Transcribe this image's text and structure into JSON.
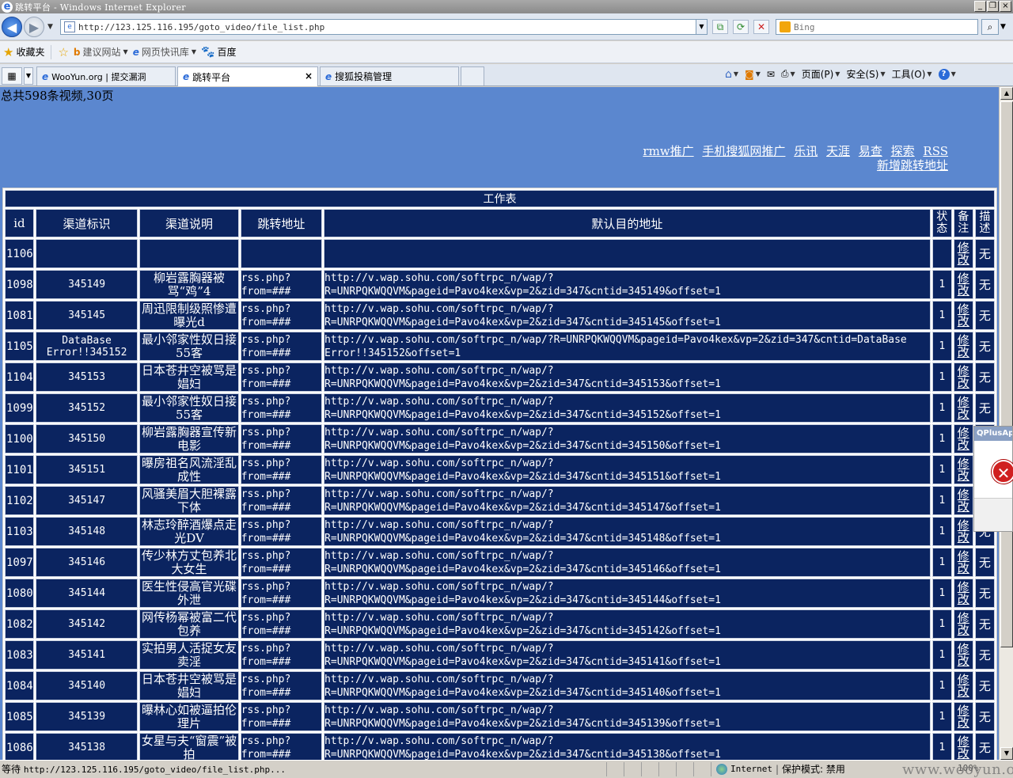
{
  "window": {
    "title": "跳转平台 - Windows Internet Explorer",
    "min": "_",
    "restore": "❐",
    "close": "×"
  },
  "address": {
    "url": "http://123.125.116.195/goto_video/file_list.php",
    "search_placeholder": "Bing"
  },
  "favorites": {
    "label": "收藏夹",
    "items": [
      {
        "label": "建议网站"
      },
      {
        "label": "网页快讯库"
      },
      {
        "label": "百度"
      }
    ]
  },
  "tabs": [
    {
      "label": "WooYun.org | 提交漏洞",
      "active": false
    },
    {
      "label": "跳转平台",
      "active": true
    },
    {
      "label": "搜狐投稿管理",
      "active": false
    }
  ],
  "commandbar": {
    "page": "页面(P)",
    "safety": "安全(S)",
    "tools": "工具(O)"
  },
  "page": {
    "total": "总共598条视频,30页",
    "nav_links": [
      {
        "label": "rmw推广"
      },
      {
        "label": "手机搜狐网推广"
      },
      {
        "label": "乐讯"
      },
      {
        "label": "天涯"
      },
      {
        "label": "易查"
      },
      {
        "label": "探索"
      },
      {
        "label": "RSS"
      }
    ],
    "add_link": "新增跳转地址"
  },
  "table": {
    "title": "工作表",
    "columns": [
      "id",
      "渠道标识",
      "渠道说明",
      "跳转地址",
      "默认目的地址",
      "状态",
      "备注",
      "描述"
    ],
    "edit_label": "修改",
    "none_label": "无",
    "rows": [
      {
        "id": "1106",
        "mark": "",
        "desc": "",
        "jump": "",
        "url": "",
        "state": ""
      },
      {
        "id": "1098",
        "mark": "345149",
        "desc": "柳岩露胸器被骂“鸡”4",
        "jump": "rss.php?from=###",
        "url": "http://v.wap.sohu.com/softrpc_n/wap/?R=UNRPQKWQQVM&pageid=Pavo4kex&vp=2&zid=347&cntid=345149&offset=1",
        "state": "1"
      },
      {
        "id": "1081",
        "mark": "345145",
        "desc": "周迅限制级照惨遭曝光d",
        "jump": "rss.php?from=###",
        "url": "http://v.wap.sohu.com/softrpc_n/wap/?R=UNRPQKWQQVM&pageid=Pavo4kex&vp=2&zid=347&cntid=345145&offset=1",
        "state": "1"
      },
      {
        "id": "1105",
        "mark": "DataBase Error!!345152",
        "desc": "最小邻家性奴日接55客",
        "jump": "rss.php?from=###",
        "url": "http://v.wap.sohu.com/softrpc_n/wap/?R=UNRPQKWQQVM&pageid=Pavo4kex&vp=2&zid=347&cntid=DataBase Error!!345152&offset=1",
        "state": "1"
      },
      {
        "id": "1104",
        "mark": "345153",
        "desc": "日本苍井空被骂是娼妇",
        "jump": "rss.php?from=###",
        "url": "http://v.wap.sohu.com/softrpc_n/wap/?R=UNRPQKWQQVM&pageid=Pavo4kex&vp=2&zid=347&cntid=345153&offset=1",
        "state": "1"
      },
      {
        "id": "1099",
        "mark": "345152",
        "desc": "最小邻家性奴日接55客",
        "jump": "rss.php?from=###",
        "url": "http://v.wap.sohu.com/softrpc_n/wap/?R=UNRPQKWQQVM&pageid=Pavo4kex&vp=2&zid=347&cntid=345152&offset=1",
        "state": "1"
      },
      {
        "id": "1100",
        "mark": "345150",
        "desc": "柳岩露胸器宣传新电影",
        "jump": "rss.php?from=###",
        "url": "http://v.wap.sohu.com/softrpc_n/wap/?R=UNRPQKWQQVM&pageid=Pavo4kex&vp=2&zid=347&cntid=345150&offset=1",
        "state": "1"
      },
      {
        "id": "1101",
        "mark": "345151",
        "desc": "曝房祖名风流淫乱成性",
        "jump": "rss.php?from=###",
        "url": "http://v.wap.sohu.com/softrpc_n/wap/?R=UNRPQKWQQVM&pageid=Pavo4kex&vp=2&zid=347&cntid=345151&offset=1",
        "state": "1"
      },
      {
        "id": "1102",
        "mark": "345147",
        "desc": "风骚美眉大胆裸露下体",
        "jump": "rss.php?from=###",
        "url": "http://v.wap.sohu.com/softrpc_n/wap/?R=UNRPQKWQQVM&pageid=Pavo4kex&vp=2&zid=347&cntid=345147&offset=1",
        "state": "1"
      },
      {
        "id": "1103",
        "mark": "345148",
        "desc": "林志玲醉酒爆点走光DV",
        "jump": "rss.php?from=###",
        "url": "http://v.wap.sohu.com/softrpc_n/wap/?R=UNRPQKWQQVM&pageid=Pavo4kex&vp=2&zid=347&cntid=345148&offset=1",
        "state": "1"
      },
      {
        "id": "1097",
        "mark": "345146",
        "desc": "传少林方丈包养北大女生",
        "jump": "rss.php?from=###",
        "url": "http://v.wap.sohu.com/softrpc_n/wap/?R=UNRPQKWQQVM&pageid=Pavo4kex&vp=2&zid=347&cntid=345146&offset=1",
        "state": "1"
      },
      {
        "id": "1080",
        "mark": "345144",
        "desc": "医生性侵高官光碟外泄",
        "jump": "rss.php?from=###",
        "url": "http://v.wap.sohu.com/softrpc_n/wap/?R=UNRPQKWQQVM&pageid=Pavo4kex&vp=2&zid=347&cntid=345144&offset=1",
        "state": "1"
      },
      {
        "id": "1082",
        "mark": "345142",
        "desc": "网传杨幂被富二代包养",
        "jump": "rss.php?from=###",
        "url": "http://v.wap.sohu.com/softrpc_n/wap/?R=UNRPQKWQQVM&pageid=Pavo4kex&vp=2&zid=347&cntid=345142&offset=1",
        "state": "1"
      },
      {
        "id": "1083",
        "mark": "345141",
        "desc": "实拍男人活捉女友卖淫",
        "jump": "rss.php?from=###",
        "url": "http://v.wap.sohu.com/softrpc_n/wap/?R=UNRPQKWQQVM&pageid=Pavo4kex&vp=2&zid=347&cntid=345141&offset=1",
        "state": "1"
      },
      {
        "id": "1084",
        "mark": "345140",
        "desc": "日本苍井空被骂是娼妇",
        "jump": "rss.php?from=###",
        "url": "http://v.wap.sohu.com/softrpc_n/wap/?R=UNRPQKWQQVM&pageid=Pavo4kex&vp=2&zid=347&cntid=345140&offset=1",
        "state": "1"
      },
      {
        "id": "1085",
        "mark": "345139",
        "desc": "曝林心如被逼拍伦理片",
        "jump": "rss.php?from=###",
        "url": "http://v.wap.sohu.com/softrpc_n/wap/?R=UNRPQKWQQVM&pageid=Pavo4kex&vp=2&zid=347&cntid=345139&offset=1",
        "state": "1"
      },
      {
        "id": "1086",
        "mark": "345138",
        "desc": "女星与夫“窗震”被拍",
        "jump": "rss.php?from=###",
        "url": "http://v.wap.sohu.com/softrpc_n/wap/?R=UNRPQKWQQVM&pageid=Pavo4kex&vp=2&zid=347&cntid=345138&offset=1",
        "state": "1"
      }
    ]
  },
  "popup": {
    "title": "QPlusAp"
  },
  "status": {
    "waiting": "等待",
    "url": "http://123.125.116.195/goto_video/file_list.php...",
    "zone": "Internet",
    "protected": "保护模式: 禁用",
    "zoom": "100%"
  },
  "watermark": "www.wooyun.org"
}
